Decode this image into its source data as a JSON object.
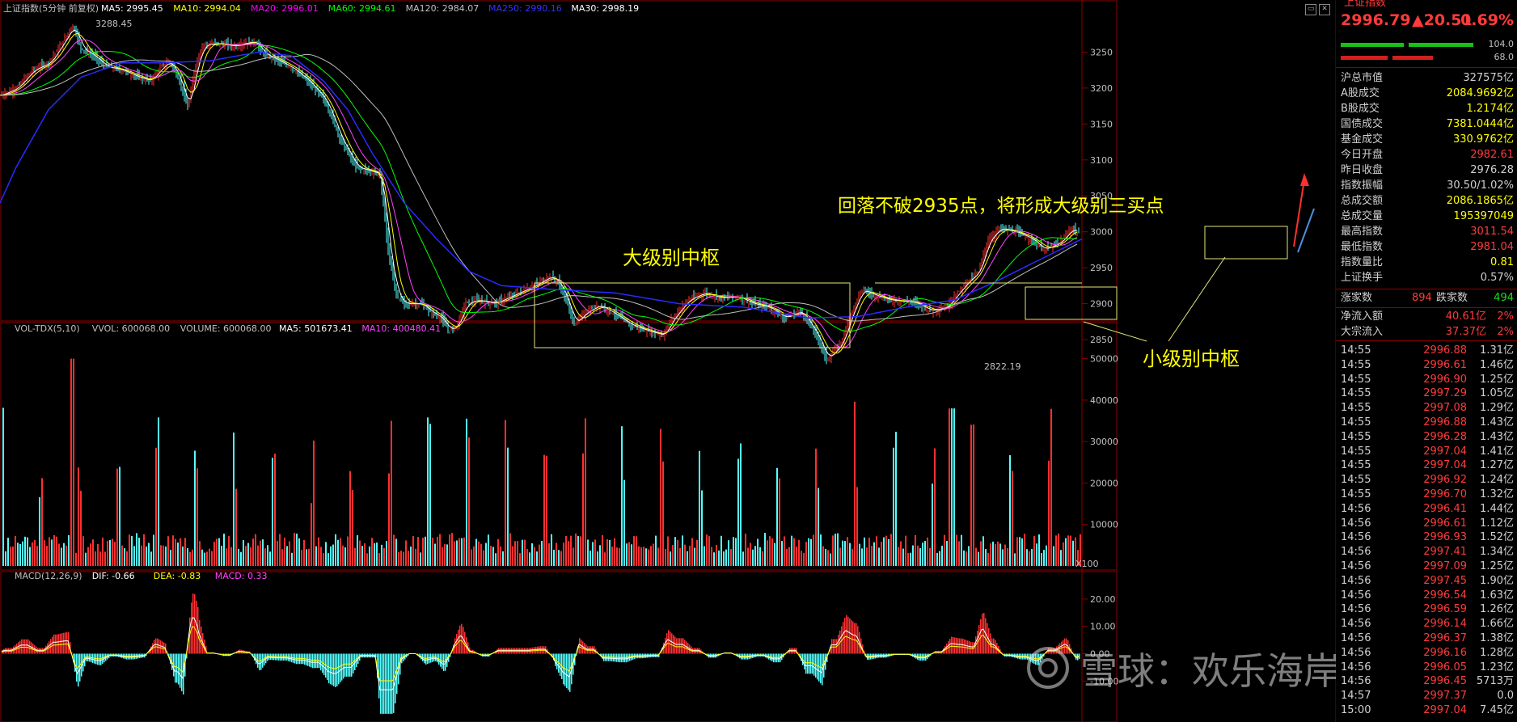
{
  "chart_data": {
    "type": "candlestick",
    "title": "上证指数(5分钟 前复权)",
    "ma_legend": [
      {
        "name": "MA5",
        "value": "2995.45",
        "color": "#ffffff"
      },
      {
        "name": "MA10",
        "value": "2994.04",
        "color": "#ffff00"
      },
      {
        "name": "MA20",
        "value": "2996.01",
        "color": "#ff00ff"
      },
      {
        "name": "MA60",
        "value": "2994.61",
        "color": "#00ff00"
      },
      {
        "name": "MA120",
        "value": "2984.07",
        "color": "#c0c0c0"
      },
      {
        "name": "MA250",
        "value": "2990.16",
        "color": "#3333ff"
      },
      {
        "name": "MA30",
        "value": "2998.19",
        "color": "#ffffff"
      }
    ],
    "price_axis": {
      "ticks": [
        3250,
        3200,
        3150,
        3100,
        3050,
        3000,
        2950,
        2900,
        2850
      ],
      "range": [
        2805,
        3300
      ]
    },
    "price_path": [
      [
        0,
        3190
      ],
      [
        20,
        3200
      ],
      [
        40,
        3225
      ],
      [
        60,
        3235
      ],
      [
        75,
        3260
      ],
      [
        90,
        3288
      ],
      [
        100,
        3255
      ],
      [
        115,
        3245
      ],
      [
        130,
        3230
      ],
      [
        150,
        3225
      ],
      [
        170,
        3215
      ],
      [
        185,
        3210
      ],
      [
        200,
        3230
      ],
      [
        210,
        3238
      ],
      [
        225,
        3200
      ],
      [
        232,
        3170
      ],
      [
        240,
        3225
      ],
      [
        250,
        3260
      ],
      [
        270,
        3262
      ],
      [
        290,
        3258
      ],
      [
        300,
        3262
      ],
      [
        315,
        3265
      ],
      [
        325,
        3248
      ],
      [
        340,
        3240
      ],
      [
        360,
        3228
      ],
      [
        380,
        3210
      ],
      [
        400,
        3185
      ],
      [
        410,
        3160
      ],
      [
        420,
        3130
      ],
      [
        440,
        3090
      ],
      [
        470,
        3080
      ],
      [
        480,
        2970
      ],
      [
        490,
        2910
      ],
      [
        500,
        2900
      ],
      [
        520,
        2900
      ],
      [
        530,
        2890
      ],
      [
        545,
        2880
      ],
      [
        555,
        2862
      ],
      [
        565,
        2870
      ],
      [
        575,
        2900
      ],
      [
        590,
        2905
      ],
      [
        610,
        2900
      ],
      [
        640,
        2915
      ],
      [
        660,
        2925
      ],
      [
        680,
        2938
      ],
      [
        690,
        2930
      ],
      [
        700,
        2905
      ],
      [
        710,
        2870
      ],
      [
        720,
        2885
      ],
      [
        740,
        2898
      ],
      [
        760,
        2885
      ],
      [
        780,
        2870
      ],
      [
        800,
        2862
      ],
      [
        820,
        2856
      ],
      [
        830,
        2878
      ],
      [
        850,
        2905
      ],
      [
        870,
        2915
      ],
      [
        890,
        2908
      ],
      [
        910,
        2910
      ],
      [
        930,
        2900
      ],
      [
        950,
        2895
      ],
      [
        970,
        2880
      ],
      [
        990,
        2890
      ],
      [
        1010,
        2855
      ],
      [
        1022,
        2822
      ],
      [
        1040,
        2845
      ],
      [
        1050,
        2880
      ],
      [
        1065,
        2920
      ],
      [
        1080,
        2912
      ],
      [
        1100,
        2905
      ],
      [
        1130,
        2902
      ],
      [
        1150,
        2890
      ],
      [
        1170,
        2895
      ],
      [
        1180,
        2910
      ],
      [
        1195,
        2930
      ],
      [
        1210,
        2945
      ],
      [
        1220,
        2985
      ],
      [
        1235,
        3005
      ],
      [
        1255,
        3000
      ],
      [
        1275,
        2990
      ],
      [
        1290,
        2975
      ],
      [
        1310,
        2985
      ],
      [
        1325,
        3005
      ],
      [
        1338,
        2996
      ]
    ],
    "ma250_path": [
      [
        0,
        3040
      ],
      [
        20,
        3090
      ],
      [
        60,
        3170
      ],
      [
        100,
        3215
      ],
      [
        150,
        3235
      ],
      [
        200,
        3235
      ],
      [
        260,
        3238
      ],
      [
        320,
        3250
      ],
      [
        360,
        3245
      ],
      [
        400,
        3210
      ],
      [
        430,
        3170
      ],
      [
        460,
        3110
      ],
      [
        500,
        3040
      ],
      [
        540,
        2990
      ],
      [
        580,
        2945
      ],
      [
        620,
        2925
      ],
      [
        680,
        2920
      ],
      [
        760,
        2915
      ],
      [
        840,
        2900
      ],
      [
        920,
        2895
      ],
      [
        1000,
        2880
      ],
      [
        1060,
        2882
      ],
      [
        1120,
        2895
      ],
      [
        1180,
        2905
      ],
      [
        1230,
        2930
      ],
      [
        1280,
        2958
      ],
      [
        1338,
        2990
      ]
    ],
    "extremes": {
      "high_label": "3288.45",
      "low_label": "2822.19"
    },
    "annotations": {
      "big_center": "大级别中枢",
      "small_center": "小级别中枢",
      "third_buy": "回落不破2935点，将形成大级别三买点"
    },
    "volume": {
      "legend": "VOL-TDX(5,10)  VVOL: 600068.00  VOLUME: 600068.00  MA5: 501673.41  MA10: 400480.41",
      "legend_parts": [
        {
          "text": "VOL-TDX(5,10)",
          "color": "#c0c0c0"
        },
        {
          "text": "VVOL: 600068.00",
          "color": "#c0c0c0"
        },
        {
          "text": "VOLUME: 600068.00",
          "color": "#c0c0c0"
        },
        {
          "text": "MA5: 501673.41",
          "color": "#ffffff"
        },
        {
          "text": "MA10: 400480.41",
          "color": "#ff44ff"
        }
      ],
      "ticks": [
        50000,
        40000,
        30000,
        20000,
        10000
      ],
      "unit": "X100",
      "range": [
        0,
        55000
      ]
    },
    "macd": {
      "legend_parts": [
        {
          "text": "MACD(12,26,9)",
          "color": "#c0c0c0"
        },
        {
          "text": "DIF: -0.66",
          "color": "#ffffff"
        },
        {
          "text": "DEA: -0.83",
          "color": "#ffff00"
        },
        {
          "text": "MACD: 0.33",
          "color": "#ff44ff"
        }
      ],
      "ticks": [
        "20.00",
        "10.00",
        "0.00",
        "-10.00"
      ],
      "tick_values": [
        20,
        10,
        0,
        -10
      ],
      "range": [
        -25,
        25
      ]
    }
  },
  "watermark": {
    "text": "雪球：欢乐海岸复盘"
  },
  "quote": {
    "name": "上证指数",
    "price": "2996.79",
    "change": "▲20.51",
    "pct": "0.69%",
    "ratio_up": "104.0",
    "ratio_down": "68.0",
    "stats": [
      {
        "k": "沪总市值",
        "v": "327575亿",
        "c": "#d0d0d0"
      },
      {
        "k": "A股成交",
        "v": "2084.9692亿",
        "c": "#ffff00"
      },
      {
        "k": "B股成交",
        "v": "1.2174亿",
        "c": "#ffff00"
      },
      {
        "k": "国债成交",
        "v": "7381.0444亿",
        "c": "#ffff00"
      },
      {
        "k": "基金成交",
        "v": "330.9762亿",
        "c": "#ffff00"
      },
      {
        "k": "今日开盘",
        "v": "2982.61",
        "c": "#ff3b3b"
      },
      {
        "k": "昨日收盘",
        "v": "2976.28",
        "c": "#d0d0d0"
      },
      {
        "k": "指数振幅",
        "v": "30.50/1.02%",
        "c": "#d0d0d0"
      },
      {
        "k": "总成交额",
        "v": "2086.1865亿",
        "c": "#ffff00"
      },
      {
        "k": "总成交量",
        "v": "195397049",
        "c": "#ffff00"
      },
      {
        "k": "最高指数",
        "v": "3011.54",
        "c": "#ff3b3b"
      },
      {
        "k": "最低指数",
        "v": "2981.04",
        "c": "#ff3b3b"
      },
      {
        "k": "指数量比",
        "v": "0.81",
        "c": "#ffff00"
      },
      {
        "k": "上证换手",
        "v": "0.57%",
        "c": "#d0d0d0"
      }
    ],
    "updown": {
      "up_label": "涨家数",
      "up": "894",
      "down_label": "跌家数",
      "down": "494"
    },
    "flows": [
      {
        "k": "净流入额",
        "v": "40.61亿",
        "p": "2%"
      },
      {
        "k": "大宗流入",
        "v": "37.37亿",
        "p": "2%"
      }
    ]
  },
  "ticks_list": [
    {
      "t": "14:55",
      "p": "2996.88",
      "q": "1.31亿"
    },
    {
      "t": "14:55",
      "p": "2996.61",
      "q": "1.46亿"
    },
    {
      "t": "14:55",
      "p": "2996.90",
      "q": "1.25亿"
    },
    {
      "t": "14:55",
      "p": "2997.29",
      "q": "1.05亿"
    },
    {
      "t": "14:55",
      "p": "2997.08",
      "q": "1.29亿"
    },
    {
      "t": "14:55",
      "p": "2996.88",
      "q": "1.43亿"
    },
    {
      "t": "14:55",
      "p": "2996.28",
      "q": "1.43亿"
    },
    {
      "t": "14:55",
      "p": "2997.04",
      "q": "1.41亿"
    },
    {
      "t": "14:55",
      "p": "2997.04",
      "q": "1.27亿"
    },
    {
      "t": "14:55",
      "p": "2996.92",
      "q": "1.24亿"
    },
    {
      "t": "14:55",
      "p": "2996.70",
      "q": "1.32亿"
    },
    {
      "t": "14:56",
      "p": "2996.41",
      "q": "1.44亿"
    },
    {
      "t": "14:56",
      "p": "2996.61",
      "q": "1.12亿"
    },
    {
      "t": "14:56",
      "p": "2996.93",
      "q": "1.52亿"
    },
    {
      "t": "14:56",
      "p": "2997.41",
      "q": "1.34亿"
    },
    {
      "t": "14:56",
      "p": "2997.09",
      "q": "1.25亿"
    },
    {
      "t": "14:56",
      "p": "2997.45",
      "q": "1.90亿"
    },
    {
      "t": "14:56",
      "p": "2996.54",
      "q": "1.63亿"
    },
    {
      "t": "14:56",
      "p": "2996.59",
      "q": "1.26亿"
    },
    {
      "t": "14:56",
      "p": "2996.14",
      "q": "1.66亿"
    },
    {
      "t": "14:56",
      "p": "2996.37",
      "q": "1.38亿"
    },
    {
      "t": "14:56",
      "p": "2996.16",
      "q": "1.28亿"
    },
    {
      "t": "14:56",
      "p": "2996.05",
      "q": "1.23亿"
    },
    {
      "t": "14:56",
      "p": "2996.45",
      "q": "5713万"
    },
    {
      "t": "14:57",
      "p": "2997.37",
      "q": "0.0"
    },
    {
      "t": "15:00",
      "p": "2997.04",
      "q": "7.45亿"
    }
  ]
}
